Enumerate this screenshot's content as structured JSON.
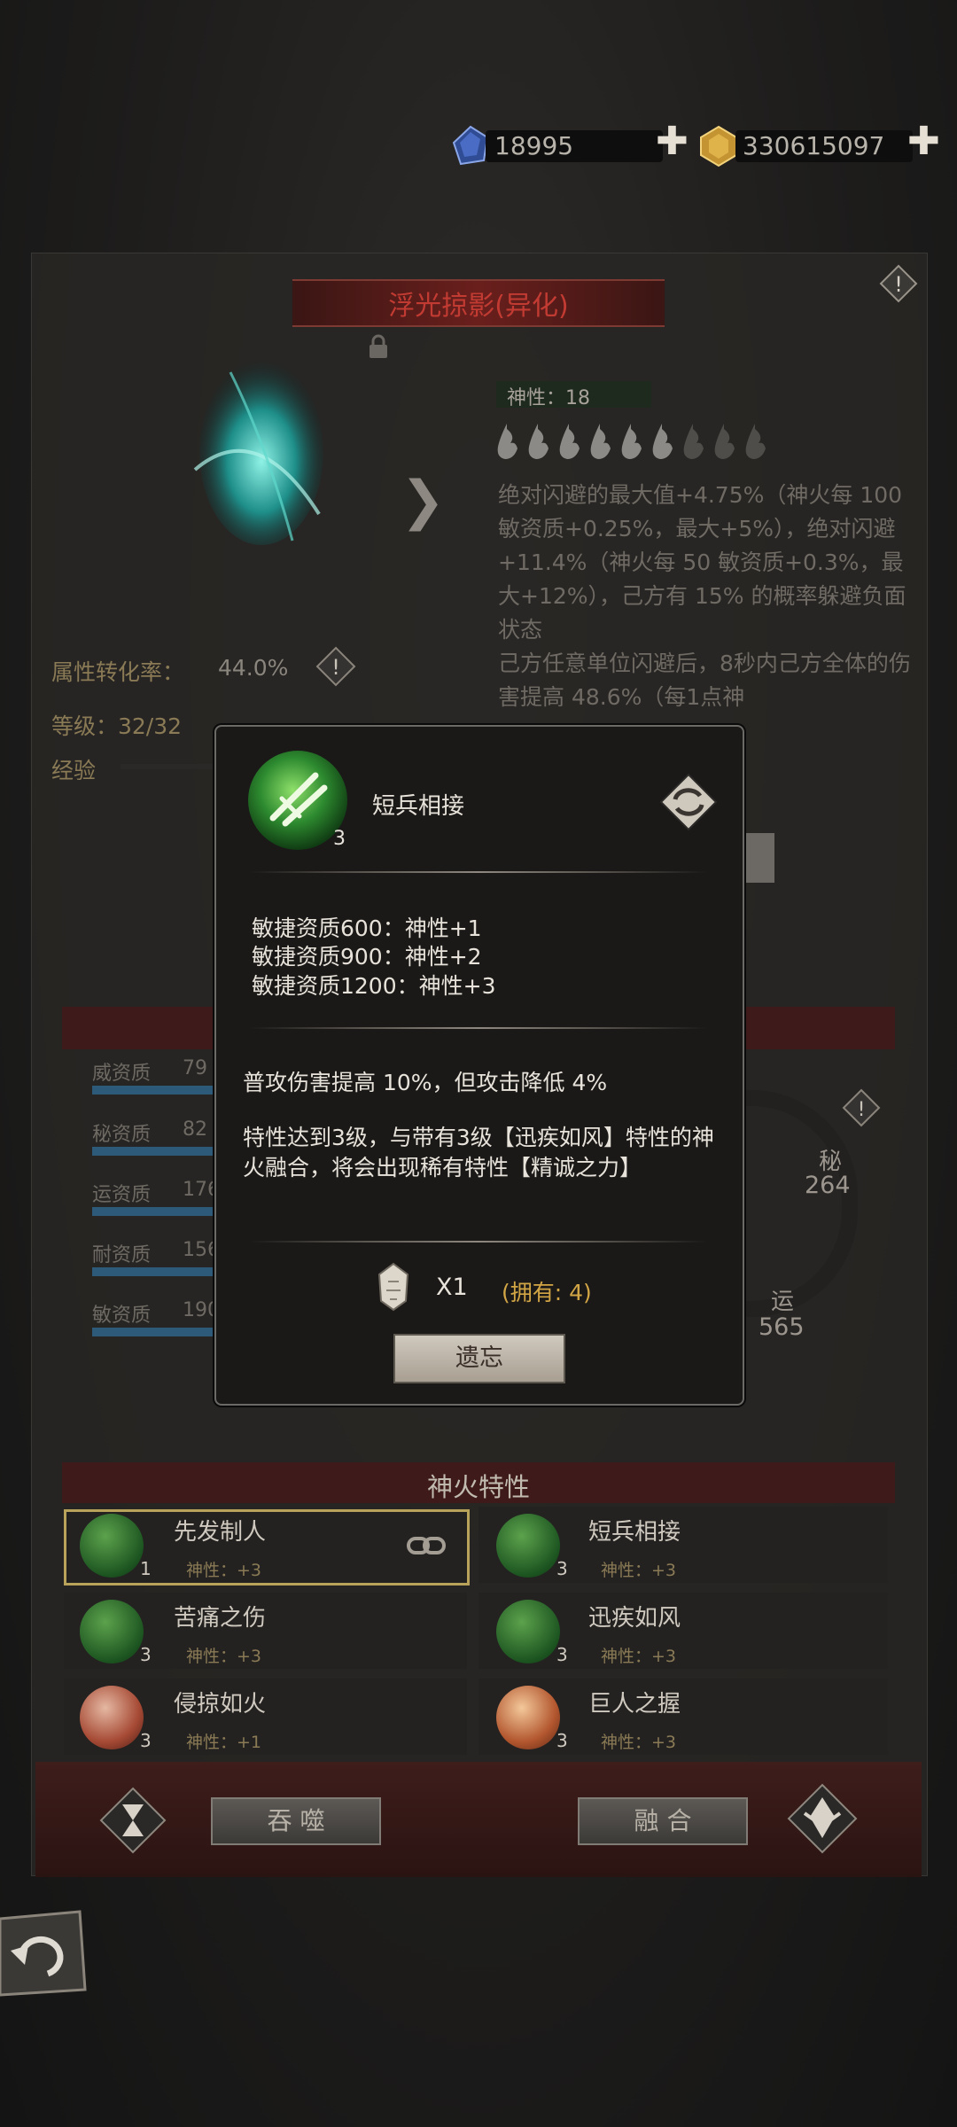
{
  "currency": {
    "gem_amount": "18995",
    "gold_amount": "330615097",
    "plus_symbol": "✚"
  },
  "item": {
    "title": "浮光掠影(异化)",
    "divinity_label": "神性：18",
    "arrow": "❯",
    "description": "绝对闪避的最大值+4.75%（神火每 100 敏资质+0.25%，最大+5%），绝对闪避+11.4%（神火每 50 敏资质+0.3%，最大+12%），己方有 15% 的概率躲避负面状态\n己方任意单位闪避后，8秒内己方全体的伤害提高 48.6%（每1点神",
    "conversion_label": "属性转化率：",
    "conversion_value": "44.0%",
    "level_label": "等级：32/32",
    "exp_label": "经验"
  },
  "attributes": [
    {
      "label": "威资质",
      "value": "79"
    },
    {
      "label": "秘资质",
      "value": "82"
    },
    {
      "label": "运资质",
      "value": "176"
    },
    {
      "label": "耐资质",
      "value": "156"
    },
    {
      "label": "敏资质",
      "value": "190"
    }
  ],
  "radar": {
    "mi_label": "秘",
    "mi_value": "264",
    "yun_label": "运",
    "yun_value": "565"
  },
  "popup": {
    "skill_name": "短兵相接",
    "skill_level": "3",
    "requirements": [
      "敏捷资质600：神性+1",
      "敏捷资质900：神性+2",
      "敏捷资质1200：神性+3"
    ],
    "effect": "普攻伤害提高 10%，但攻击降低 4%",
    "fusion_note": "特性达到3级，与带有3级【迅疾如风】特性的神火融合，将会出现稀有特性【精诚之力】",
    "cost": "X1",
    "owned": "(拥有: 4)",
    "forget_button": "遗忘"
  },
  "traits_section": {
    "title": "神火特性",
    "items": [
      {
        "name": "先发制人",
        "level": "1",
        "bonus": "神性：+3",
        "icon": "green"
      },
      {
        "name": "短兵相接",
        "level": "3",
        "bonus": "神性：+3",
        "icon": "green"
      },
      {
        "name": "苦痛之伤",
        "level": "3",
        "bonus": "神性：+3",
        "icon": "green"
      },
      {
        "name": "迅疾如风",
        "level": "3",
        "bonus": "神性：+3",
        "icon": "green"
      },
      {
        "name": "侵掠如火",
        "level": "3",
        "bonus": "神性：+1",
        "icon": "red"
      },
      {
        "name": "巨人之握",
        "level": "3",
        "bonus": "神性：+3",
        "icon": "orange"
      }
    ]
  },
  "actions": {
    "devour_button": "吞 噬",
    "fuse_button": "融 合"
  }
}
